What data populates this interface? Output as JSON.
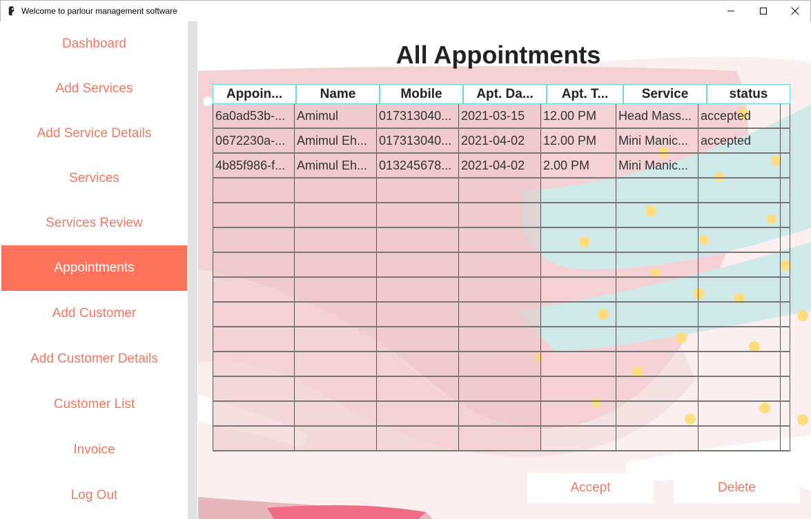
{
  "window": {
    "title": "Welcome to parlour management software"
  },
  "sidebar": {
    "items": [
      {
        "label": "Dashboard"
      },
      {
        "label": "Add Services"
      },
      {
        "label": "Add Service Details"
      },
      {
        "label": "Services"
      },
      {
        "label": "Services Review"
      },
      {
        "label": "Appointments"
      },
      {
        "label": "Add Customer"
      },
      {
        "label": "Add Customer Details"
      },
      {
        "label": "Customer List"
      },
      {
        "label": "Invoice"
      },
      {
        "label": "Log Out"
      }
    ],
    "active_index": 5
  },
  "main": {
    "title": "All Appointments",
    "table": {
      "headers": [
        "Appoin...",
        "Name",
        "Mobile",
        "Apt. Da...",
        "Apt. T...",
        "Service",
        "status"
      ],
      "rows": [
        [
          "6a0ad53b-...",
          "Amimul",
          "017313040...",
          "2021-03-15",
          "12.00 PM",
          "Head Mass...",
          "accepted"
        ],
        [
          "0672230a-...",
          "Amimul Eh...",
          "017313040...",
          "2021-04-02",
          "12.00 PM",
          "Mini Manic...",
          "accepted"
        ],
        [
          "4b85f986-f...",
          "Amimul Eh...",
          "013245678...",
          "2021-04-02",
          "2.00 PM",
          "Mini Manic...",
          ""
        ]
      ],
      "empty_rows": 11
    },
    "buttons": {
      "accept": "Accept",
      "delete": "Delete"
    }
  },
  "colors": {
    "accent": "#ff735c",
    "nav_text": "#f4775f",
    "header_border": "#63e2c9",
    "bg_pink": "#fbeff0",
    "teal": "#cfe9e8",
    "dot_yellow": "#fddd7f"
  },
  "icons": {
    "app": "parlour-logo-icon",
    "minimize": "minimize-icon",
    "maximize": "maximize-icon",
    "close": "close-icon"
  }
}
